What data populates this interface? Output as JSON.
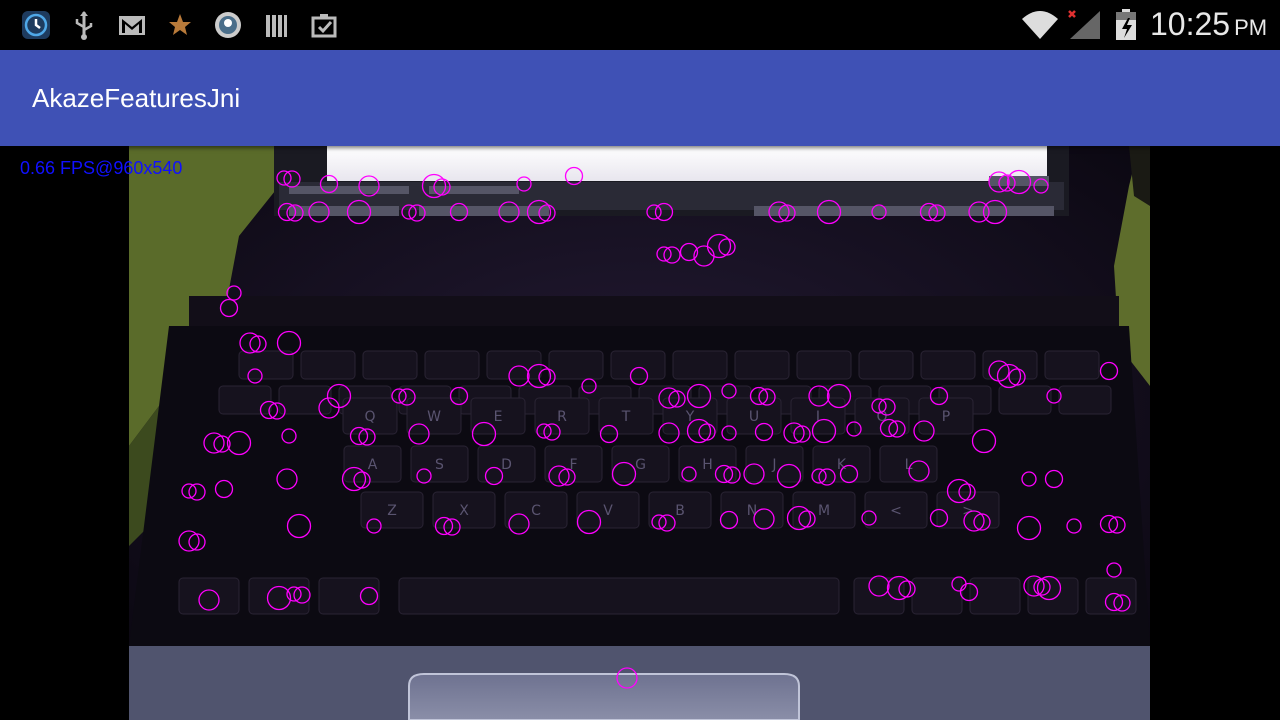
{
  "status_bar": {
    "icons_left": [
      "app-notification-icon",
      "usb-icon",
      "gmail-icon",
      "star-app-icon",
      "photo-app-icon",
      "library-icon",
      "clipboard-check-icon"
    ],
    "icons_right": [
      "wifi-icon",
      "signal-no-service-icon",
      "battery-charging-icon"
    ],
    "time": "10:25",
    "ampm": "PM"
  },
  "app_bar": {
    "title": "AkazeFeaturesJni"
  },
  "overlay": {
    "fps_text": "0.66 FPS@960x540"
  },
  "camera_view": {
    "description_icon": "camera-preview",
    "keypoint_color": "#ff00ff",
    "keyboard_keys": [
      [
        "Q",
        "W",
        "E",
        "R",
        "T",
        "Y",
        "U",
        "I",
        "O",
        "P"
      ],
      [
        "A",
        "S",
        "D",
        "F",
        "G",
        "H",
        "J",
        "K",
        "L"
      ],
      [
        "Z",
        "X",
        "C",
        "V",
        "B",
        "N",
        "M",
        "<",
        ">"
      ]
    ]
  }
}
